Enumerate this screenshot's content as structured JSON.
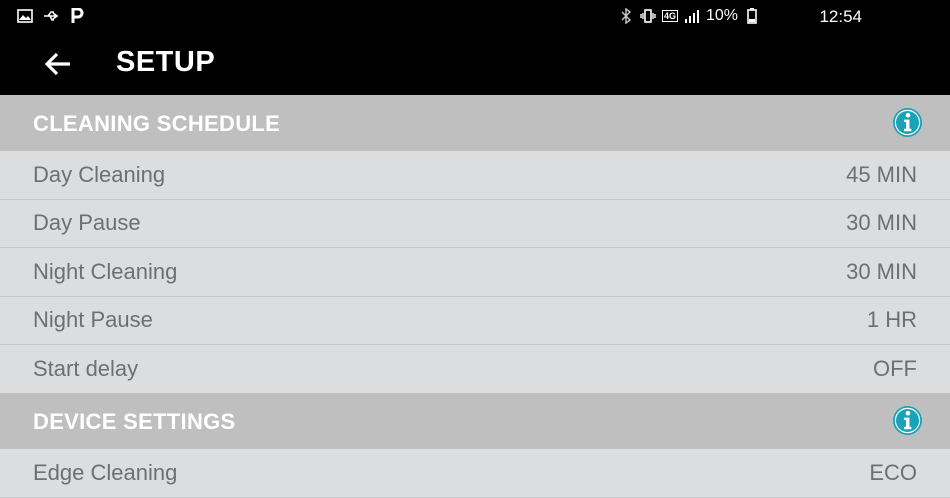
{
  "status_bar": {
    "battery_percent": "10%",
    "time": "12:54",
    "network": "4G",
    "icons_left": [
      "image-icon",
      "usb-icon",
      "parking-icon"
    ],
    "icons_right": [
      "bluetooth-icon",
      "vibrate-icon",
      "network-4g-icon",
      "signal-icon",
      "battery-icon"
    ]
  },
  "app_bar": {
    "title": "SETUP"
  },
  "sections": [
    {
      "title": "CLEANING SCHEDULE",
      "rows": [
        {
          "label": "Day Cleaning",
          "value": "45 MIN"
        },
        {
          "label": "Day Pause",
          "value": "30 MIN"
        },
        {
          "label": "Night Cleaning",
          "value": "30 MIN"
        },
        {
          "label": "Night Pause",
          "value": "1 HR"
        },
        {
          "label": "Start delay",
          "value": "OFF"
        }
      ]
    },
    {
      "title": "DEVICE SETTINGS",
      "rows": [
        {
          "label": "Edge Cleaning",
          "value": "ECO"
        }
      ]
    }
  ],
  "colors": {
    "info_icon": "#1aa3b8",
    "section_header": "#bfbfbf",
    "row_bg": "#dcdddf",
    "text": "#6f6f6f"
  }
}
